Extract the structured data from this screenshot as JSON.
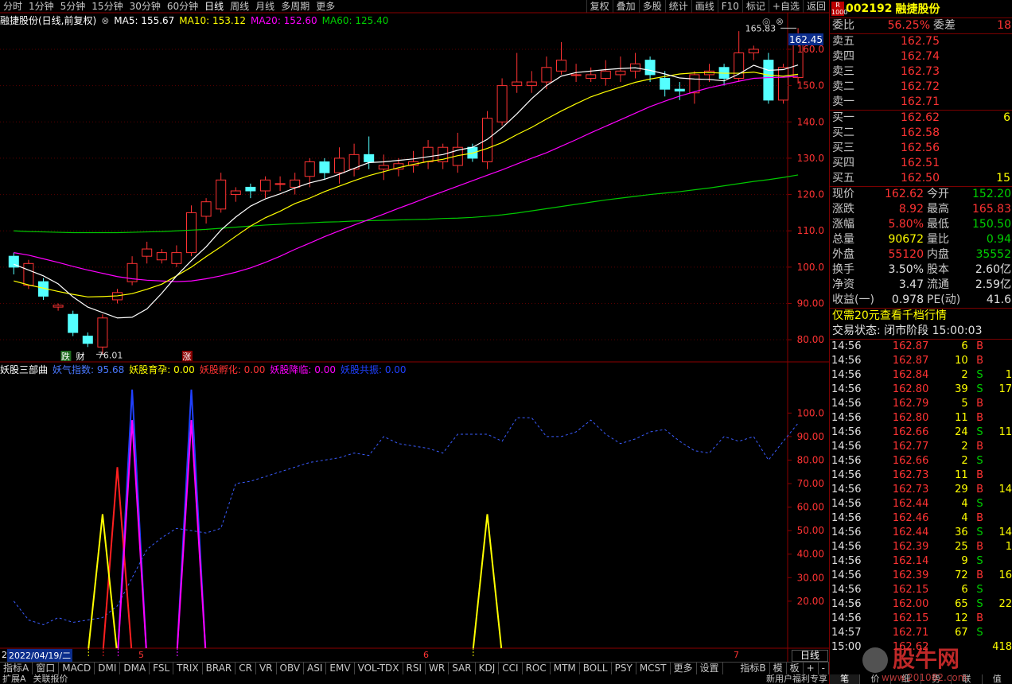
{
  "toolbar": {
    "items": [
      "分时",
      "1分钟",
      "5分钟",
      "15分钟",
      "30分钟",
      "60分钟",
      "日线",
      "周线",
      "月线",
      "多周期",
      "更多"
    ],
    "right": [
      "复权",
      "叠加",
      "多股",
      "统计",
      "画线",
      "F10",
      "标记",
      "+自选",
      "返回"
    ]
  },
  "chart_header": {
    "title": "融捷股份(日线,前复权)",
    "ma5": "MA5: 155.67",
    "ma10": "MA10: 153.12",
    "ma20": "MA20: 152.60",
    "ma60": "MA60: 125.40"
  },
  "price_axis": [
    "160.0",
    "150.0",
    "140.0",
    "130.0",
    "120.0",
    "110.0",
    "100.0",
    "90.00",
    "80.00"
  ],
  "price_badge": "162.45",
  "high_label": "165.83",
  "low_label": "76.01",
  "markers": {
    "down": "跌",
    "cai": "财",
    "up": "涨"
  },
  "indicator": {
    "name": "妖股三部曲",
    "l1": "妖气指数: 95.68",
    "l2": "妖股育孕: 0.00",
    "l3": "妖股孵化: 0.00",
    "l4": "妖股降临: 0.00",
    "l5": "妖股共振: 0.00"
  },
  "ind_axis": [
    "100.0",
    "90.00",
    "80.00",
    "70.00",
    "60.00",
    "50.00",
    "40.00",
    "30.00",
    "20.00"
  ],
  "time_axis": {
    "date": "2022/04/19/二",
    "m5": "5",
    "m6": "6",
    "m7": "7",
    "lead": "2"
  },
  "period_button": "日线",
  "tabs": [
    "指标A",
    "窗口",
    "MACD",
    "DMI",
    "DMA",
    "FSL",
    "TRIX",
    "BRAR",
    "CR",
    "VR",
    "OBV",
    "ASI",
    "EMV",
    "VOL-TDX",
    "RSI",
    "WR",
    "SAR",
    "KDJ",
    "CCI",
    "ROC",
    "MTM",
    "BOLL",
    "PSY",
    "MCST",
    "更多",
    "设置"
  ],
  "tabs_right": [
    "指标B",
    "模",
    "板",
    "+",
    "-"
  ],
  "status": {
    "left1": "扩展A",
    "left2": "关联报价",
    "right": "新用户福利专享"
  },
  "colors": {
    "up": "#ff3333",
    "down": "#54ffff",
    "ma5": "#ffffff",
    "ma10": "#ffff00",
    "ma20": "#ff00ff",
    "ma60": "#00c800"
  },
  "quote": {
    "code": "002192",
    "name": "融捷股份",
    "r_badge": "R",
    "r_sub": "1000",
    "weibi": {
      "label": "委比",
      "value": "56.25%",
      "label2": "委差",
      "value2": "18"
    },
    "asks": [
      {
        "l": "卖五",
        "p": "162.75",
        "v": ""
      },
      {
        "l": "卖四",
        "p": "162.74",
        "v": ""
      },
      {
        "l": "卖三",
        "p": "162.73",
        "v": ""
      },
      {
        "l": "卖二",
        "p": "162.72",
        "v": ""
      },
      {
        "l": "卖一",
        "p": "162.71",
        "v": ""
      }
    ],
    "bids": [
      {
        "l": "买一",
        "p": "162.62",
        "v": "6"
      },
      {
        "l": "买二",
        "p": "162.58",
        "v": ""
      },
      {
        "l": "买三",
        "p": "162.56",
        "v": ""
      },
      {
        "l": "买四",
        "p": "162.51",
        "v": ""
      },
      {
        "l": "买五",
        "p": "162.50",
        "v": "15"
      }
    ],
    "stats": [
      {
        "a": "现价",
        "av": "162.62",
        "b": "今开",
        "bv": "152.20",
        "ac": "red",
        "bc": "green"
      },
      {
        "a": "涨跌",
        "av": "8.92",
        "b": "最高",
        "bv": "165.83",
        "ac": "red",
        "bc": "red"
      },
      {
        "a": "涨幅",
        "av": "5.80%",
        "b": "最低",
        "bv": "150.50",
        "ac": "red",
        "bc": "green"
      },
      {
        "a": "总量",
        "av": "90672",
        "b": "量比",
        "bv": "0.94",
        "ac": "yellow",
        "bc": "green"
      },
      {
        "a": "外盘",
        "av": "55120",
        "b": "内盘",
        "bv": "35552",
        "ac": "red",
        "bc": "green"
      },
      {
        "a": "换手",
        "av": "3.50%",
        "b": "股本",
        "bv": "2.60亿",
        "ac": "white",
        "bc": "white"
      },
      {
        "a": "净资",
        "av": "3.47",
        "b": "流通",
        "bv": "2.59亿",
        "ac": "white",
        "bc": "white"
      },
      {
        "a": "收益(一)",
        "av": "0.978",
        "b": "PE(动)",
        "bv": "41.6",
        "ac": "white",
        "bc": "white"
      }
    ],
    "promo": "仅需20元查看千档行情",
    "trade_status": "交易状态: 闭市阶段 15:00:03",
    "ticks": [
      {
        "t": "14:56",
        "p": "162.87",
        "v": "6",
        "s": "B",
        "x": ""
      },
      {
        "t": "14:56",
        "p": "162.87",
        "v": "10",
        "s": "B",
        "x": ""
      },
      {
        "t": "14:56",
        "p": "162.84",
        "v": "2",
        "s": "S",
        "x": "1"
      },
      {
        "t": "14:56",
        "p": "162.80",
        "v": "39",
        "s": "S",
        "x": "17"
      },
      {
        "t": "14:56",
        "p": "162.79",
        "v": "5",
        "s": "B",
        "x": ""
      },
      {
        "t": "14:56",
        "p": "162.80",
        "v": "11",
        "s": "B",
        "x": ""
      },
      {
        "t": "14:56",
        "p": "162.66",
        "v": "24",
        "s": "S",
        "x": "11"
      },
      {
        "t": "14:56",
        "p": "162.77",
        "v": "2",
        "s": "B",
        "x": ""
      },
      {
        "t": "14:56",
        "p": "162.66",
        "v": "2",
        "s": "S",
        "x": ""
      },
      {
        "t": "14:56",
        "p": "162.73",
        "v": "11",
        "s": "B",
        "x": ""
      },
      {
        "t": "14:56",
        "p": "162.73",
        "v": "29",
        "s": "B",
        "x": "14"
      },
      {
        "t": "14:56",
        "p": "162.44",
        "v": "4",
        "s": "S",
        "x": ""
      },
      {
        "t": "14:56",
        "p": "162.46",
        "v": "4",
        "s": "B",
        "x": ""
      },
      {
        "t": "14:56",
        "p": "162.44",
        "v": "36",
        "s": "S",
        "x": "14"
      },
      {
        "t": "14:56",
        "p": "162.39",
        "v": "25",
        "s": "B",
        "x": "1"
      },
      {
        "t": "14:56",
        "p": "162.14",
        "v": "9",
        "s": "S",
        "x": ""
      },
      {
        "t": "14:56",
        "p": "162.39",
        "v": "72",
        "s": "B",
        "x": "16"
      },
      {
        "t": "14:56",
        "p": "162.15",
        "v": "6",
        "s": "S",
        "x": ""
      },
      {
        "t": "14:56",
        "p": "162.00",
        "v": "65",
        "s": "S",
        "x": "22"
      },
      {
        "t": "14:56",
        "p": "162.15",
        "v": "12",
        "s": "B",
        "x": ""
      },
      {
        "t": "14:57",
        "p": "162.71",
        "v": "67",
        "s": "S",
        "x": ""
      },
      {
        "t": "15:00",
        "p": "162.62",
        "v": "",
        "s": "",
        "x": "418"
      }
    ],
    "bottom_tabs": [
      "笔",
      "价",
      "细",
      "势",
      "联",
      "值"
    ]
  },
  "watermark": {
    "text": "股牛网",
    "url": "www.201082.com"
  },
  "chart_data": {
    "type": "candlestick",
    "title": "融捷股份(日线,前复权)",
    "ylim": [
      75,
      167
    ],
    "candles": [
      [
        103.0,
        100.0,
        104.0,
        98.0
      ],
      [
        95.0,
        101.0,
        102.0,
        94.0
      ],
      [
        96.0,
        92.0,
        97.0,
        91.0
      ],
      [
        89.0,
        89.5,
        90.0,
        88.0
      ],
      [
        87.0,
        82.0,
        88.0,
        81.0
      ],
      [
        81.0,
        79.0,
        82.0,
        78.0
      ],
      [
        78.0,
        86.0,
        87.0,
        76.01
      ],
      [
        91.0,
        93.0,
        94.0,
        90.0
      ],
      [
        96.0,
        101.0,
        103.0,
        95.0
      ],
      [
        103.0,
        105.0,
        107.0,
        101.0
      ],
      [
        102.0,
        104.0,
        105.0,
        101.0
      ],
      [
        101.0,
        104.0,
        106.0,
        100.0
      ],
      [
        104.0,
        115.0,
        117.0,
        103.0
      ],
      [
        114.0,
        118.0,
        119.0,
        112.0
      ],
      [
        116.0,
        124.0,
        126.0,
        115.0
      ],
      [
        120.0,
        121.0,
        122.0,
        118.0
      ],
      [
        122.0,
        121.0,
        123.0,
        119.0
      ],
      [
        121.0,
        124.0,
        125.0,
        119.0
      ],
      [
        123.0,
        123.0,
        125.0,
        121.0
      ],
      [
        122.0,
        124.0,
        126.0,
        120.0
      ],
      [
        125.0,
        129.0,
        130.0,
        122.0
      ],
      [
        129.0,
        126.0,
        130.0,
        124.0
      ],
      [
        126.0,
        130.0,
        133.0,
        123.0
      ],
      [
        127.0,
        131.0,
        134.0,
        125.0
      ],
      [
        131.0,
        129.0,
        136.0,
        127.0
      ],
      [
        127.0,
        128.0,
        131.0,
        124.0
      ],
      [
        127.0,
        128.5,
        130.0,
        125.0
      ],
      [
        128.0,
        129.0,
        132.0,
        126.0
      ],
      [
        129.0,
        133.0,
        135.0,
        127.0
      ],
      [
        129.0,
        133.0,
        134.0,
        127.0
      ],
      [
        128.0,
        133.0,
        137.0,
        126.0
      ],
      [
        133.0,
        130.0,
        134.0,
        129.0
      ],
      [
        129.0,
        141.0,
        143.0,
        127.0
      ],
      [
        140.0,
        150.0,
        152.0,
        139.0
      ],
      [
        150.0,
        151.0,
        159.0,
        148.0
      ],
      [
        150.0,
        151.0,
        154.0,
        148.0
      ],
      [
        151.0,
        155.0,
        158.0,
        149.0
      ],
      [
        154.0,
        157.0,
        162.0,
        153.0
      ],
      [
        153.0,
        153.0,
        156.0,
        151.0
      ],
      [
        152.0,
        153.0,
        155.0,
        151.0
      ],
      [
        152.0,
        154.0,
        157.0,
        150.0
      ],
      [
        153.0,
        154.0,
        158.0,
        151.0
      ],
      [
        154.0,
        156.0,
        159.0,
        152.0
      ],
      [
        157.0,
        153.0,
        158.0,
        151.0
      ],
      [
        152.0,
        149.0,
        154.0,
        147.0
      ],
      [
        149.0,
        148.5,
        151.0,
        146.0
      ],
      [
        148.0,
        153.0,
        154.0,
        145.0
      ],
      [
        153.0,
        154.0,
        156.0,
        151.0
      ],
      [
        155.0,
        152.0,
        156.0,
        150.0
      ],
      [
        152.0,
        159.0,
        165.0,
        151.0
      ],
      [
        159.0,
        160.0,
        161.0,
        157.0
      ],
      [
        157.0,
        146.0,
        159.0,
        145.0
      ],
      [
        146.0,
        155.0,
        156.0,
        145.0
      ],
      [
        152.2,
        162.62,
        165.83,
        150.5
      ]
    ],
    "ma5": [
      100.8,
      99.2,
      97.6,
      95.4,
      91.8,
      89.0,
      87.5,
      86.0,
      86.2,
      88.5,
      92.8,
      97.6,
      101.8,
      105.6,
      110.2,
      113.8,
      116.8,
      118.8,
      120.2,
      121.8,
      123.2,
      124.2,
      125.6,
      127.2,
      128.8,
      129.0,
      129.4,
      129.8,
      130.4,
      131.0,
      132.2,
      133.0,
      135.2,
      138.4,
      142.2,
      146.4,
      150.0,
      152.6,
      153.6,
      154.0,
      154.4,
      154.7,
      154.9,
      154.2,
      153.2,
      152.1,
      151.8,
      151.7,
      151.3,
      153.2,
      155.6,
      154.2,
      154.4,
      155.67
    ],
    "ma10": [
      96.2,
      95.1,
      94.2,
      93.3,
      92.5,
      91.8,
      91.9,
      92.1,
      92.7,
      93.9,
      95.3,
      97.6,
      100.0,
      102.9,
      105.6,
      108.5,
      111.3,
      113.6,
      115.4,
      117.5,
      119.0,
      120.8,
      122.3,
      123.8,
      125.2,
      126.3,
      127.4,
      128.3,
      129.1,
      129.7,
      130.7,
      131.4,
      132.7,
      134.3,
      136.5,
      138.5,
      140.8,
      143.0,
      145.0,
      146.9,
      148.3,
      149.6,
      150.9,
      151.8,
      152.5,
      153.2,
      153.5,
      153.6,
      153.4,
      153.4,
      153.7,
      152.9,
      152.6,
      153.12
    ],
    "ma20": [
      104.0,
      103.3,
      102.3,
      101.3,
      100.2,
      99.2,
      98.3,
      97.4,
      96.8,
      96.4,
      96.2,
      96.0,
      96.2,
      96.8,
      97.6,
      98.6,
      99.8,
      101.3,
      103.0,
      104.9,
      106.6,
      108.4,
      110.0,
      111.6,
      113.1,
      114.6,
      116.2,
      117.7,
      119.3,
      120.8,
      122.3,
      123.8,
      125.3,
      126.8,
      128.4,
      130.0,
      131.5,
      133.3,
      135.1,
      137.0,
      138.8,
      140.6,
      142.4,
      144.2,
      145.7,
      147.1,
      148.3,
      149.4,
      150.3,
      151.2,
      152.0,
      152.2,
      152.3,
      152.6
    ],
    "ma60": [
      110.0,
      109.8,
      109.7,
      109.6,
      109.5,
      109.5,
      109.5,
      109.5,
      109.6,
      109.7,
      109.8,
      110.0,
      110.2,
      110.4,
      110.7,
      111.0,
      111.3,
      111.6,
      111.8,
      112.0,
      112.2,
      112.4,
      112.5,
      112.7,
      112.8,
      112.9,
      113.0,
      113.1,
      113.2,
      113.4,
      113.5,
      113.7,
      114.0,
      114.4,
      114.9,
      115.5,
      116.1,
      116.7,
      117.3,
      117.9,
      118.5,
      119.0,
      119.5,
      120.0,
      120.4,
      120.8,
      121.3,
      121.8,
      122.4,
      123.0,
      123.6,
      124.1,
      124.7,
      125.4
    ],
    "indicator_ylim": [
      0,
      115
    ],
    "yaoqi": [
      20,
      12,
      10,
      13,
      11,
      12,
      13,
      18,
      30,
      42,
      47,
      51,
      50,
      49,
      51,
      70,
      71,
      73,
      75,
      77,
      79,
      80,
      81,
      83,
      82,
      90,
      87,
      86,
      85,
      83,
      91,
      91,
      91,
      88,
      98,
      98,
      90,
      90,
      92,
      97,
      91,
      87,
      89,
      92,
      93,
      88,
      84,
      83,
      90,
      88,
      90,
      80,
      88,
      95.68
    ],
    "yuyun": [
      0,
      0,
      0,
      0,
      0,
      0,
      57,
      0,
      0,
      0,
      0,
      0,
      0,
      0,
      0,
      0,
      0,
      0,
      0,
      0,
      0,
      0,
      0,
      0,
      0,
      0,
      0,
      0,
      0,
      0,
      0,
      0,
      57,
      0,
      0,
      0,
      0,
      0,
      0,
      0,
      0,
      0,
      0,
      0,
      0,
      0,
      0,
      0,
      0,
      0,
      0,
      0,
      0,
      0
    ],
    "fuhua": [
      0,
      0,
      0,
      0,
      0,
      0,
      0,
      77,
      0,
      0,
      0,
      0,
      0,
      0,
      0,
      0,
      0,
      0,
      0,
      0,
      0,
      0,
      0,
      0,
      0,
      0,
      0,
      0,
      0,
      0,
      0,
      0,
      0,
      0,
      0,
      0,
      0,
      0,
      0,
      0,
      0,
      0,
      0,
      0,
      0,
      0,
      0,
      0,
      0,
      0,
      0,
      0,
      0,
      0
    ],
    "jianglin": [
      0,
      0,
      0,
      0,
      0,
      0,
      0,
      0,
      97,
      0,
      0,
      0,
      97,
      0,
      0,
      0,
      0,
      0,
      0,
      0,
      0,
      0,
      0,
      0,
      0,
      0,
      0,
      0,
      0,
      0,
      0,
      0,
      0,
      0,
      0,
      0,
      0,
      0,
      0,
      0,
      0,
      0,
      0,
      0,
      0,
      0,
      0,
      0,
      0,
      0,
      0,
      0,
      0,
      0
    ],
    "gongzhen": [
      0,
      0,
      0,
      0,
      0,
      0,
      0,
      0,
      110,
      0,
      0,
      0,
      110,
      0,
      0,
      0,
      0,
      0,
      0,
      0,
      0,
      0,
      0,
      0,
      0,
      0,
      0,
      0,
      0,
      0,
      0,
      0,
      0,
      0,
      0,
      0,
      0,
      0,
      0,
      0,
      0,
      0,
      0,
      0,
      0,
      0,
      0,
      0,
      0,
      0,
      0,
      0,
      0,
      0
    ]
  }
}
